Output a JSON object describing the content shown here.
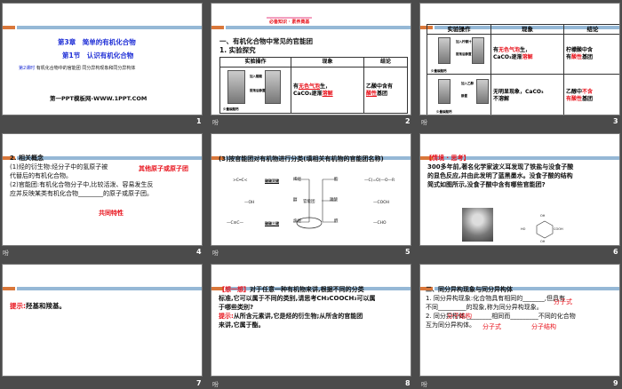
{
  "slides": [
    {
      "number": "1",
      "chapter": "第3章　简单的有机化合物",
      "section": "第1节　认识有机化合物",
      "lesson_label": "第2课时",
      "lesson": "有机化合物中的官能团 同分异构现象和同分异构体",
      "site": "第一PPT模板网-WWW.1PPT.COM"
    },
    {
      "number": "2",
      "anim": "吩",
      "banner": "必备知识 · 素养奠基",
      "title": "一、有机化合物中常见的官能团",
      "subtitle": "1. 实验探究",
      "headers": [
        "实验操作",
        "现象",
        "结论"
      ],
      "op_labels": [
        "加入醋酸",
        "振荡后静置",
        "少量碳酸钙"
      ],
      "phenomenon": [
        "有",
        "无色气泡",
        "生，",
        "CaCO₃逐渐",
        "溶解"
      ],
      "conclusion": [
        "乙酸中含有",
        "酸性",
        "基团"
      ]
    },
    {
      "number": "3",
      "anim": "吩",
      "headers": [
        "实验操作",
        "现象",
        "结论"
      ],
      "row1": {
        "ops": [
          "加入柠檬汁",
          "振荡后静置",
          "少量碳酸钙"
        ],
        "phenomenon": [
          "有",
          "无色气泡",
          "生，",
          "CaCO₃逐渐",
          "溶解"
        ],
        "conclusion": [
          "柠檬酸中含",
          "有",
          "酸性",
          "基团"
        ]
      },
      "row2": {
        "ops": [
          "加入乙醇",
          "静置",
          "少量碳酸钙"
        ],
        "phenomenon": [
          "无明显现象，CaCO₃",
          "不溶解"
        ],
        "conclusion": [
          "乙醇中",
          "不含",
          "有酸性",
          "基团"
        ]
      }
    },
    {
      "number": "4",
      "anim": "吩",
      "heading": "2. 相关概念",
      "l1": "(1)烃的衍生物:烃分子中的氢原子被",
      "a1": "其他原子或原子团",
      "l2": "代替后的有机化合物。",
      "l3": "(2)官能团:有机化合物分子中,比较活泼、容易发生反",
      "l4": "应并反映某类有机化合物________的原子或原子团。",
      "a2": "共同特性"
    },
    {
      "number": "5",
      "anim": "吩",
      "heading": "(3)按官能团对有机物进行分类(填相关有机物的官能团名称)",
      "center": "官能团",
      "left": [
        "烯烃",
        "醇",
        "炔烃"
      ],
      "right": [
        "酯",
        "羧酸",
        "醛"
      ],
      "left_groups": [
        ">C═C<",
        "—OH",
        "—C≡C—"
      ],
      "left_names": [
        "碳碳双键",
        "碳碳三键"
      ],
      "right_groups": [
        "—C(=O)—O—R",
        "—COOH",
        "—CHO"
      ]
    },
    {
      "number": "6",
      "tag": "【情境 · 思考】",
      "text": [
        "300多年前,著名化学家波义耳发现了铁盐与没食子酸",
        "的显色反应,并由此发明了蓝黑墨水。没食子酸的结构",
        "简式如图所示,没食子酸中含有哪些官能团?"
      ],
      "formula": [
        "OH",
        "HO",
        "COOH",
        "OH"
      ]
    },
    {
      "number": "7",
      "hint": "提示:",
      "text": "羟基和羧基。"
    },
    {
      "number": "8",
      "anim": "吩",
      "tag": "【想一想】",
      "text": [
        "对于任意一种有机物来讲,根据不同的分类",
        "标准,它可以属于不同的类别,请思考CH₃COOCH₃可以属",
        "于哪些类别?"
      ],
      "hint": "提示:",
      "hint_text": [
        "从所含元素讲,它是烃的衍生物;从所含的官能团",
        "来讲,它属于酯。"
      ]
    },
    {
      "number": "9",
      "anim": "吩",
      "heading": "二、同分异构现象与同分异构体",
      "l1": "1. 同分异构现象:化合物具有相同的_______,但具有",
      "l2": "不同_________的现象,称为同分异构现象。",
      "l3": "2. 同分异构体:________相同而_________不同的化合物",
      "l4": "互为同分异构体。",
      "answers": [
        "分子式",
        "分子结构",
        "分子式",
        "分子结构"
      ]
    }
  ]
}
